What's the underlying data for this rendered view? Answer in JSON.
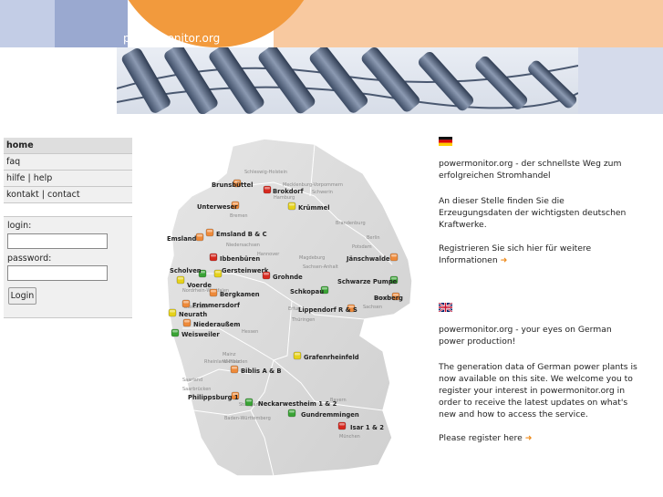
{
  "site": {
    "title": "powermonitor.org"
  },
  "nav": {
    "items": [
      {
        "label": "home",
        "active": true
      },
      {
        "label": "faq"
      },
      {
        "label": "hilfe | help"
      },
      {
        "label": "kontakt | contact"
      }
    ]
  },
  "login": {
    "login_label": "login:",
    "password_label": "password:",
    "button_label": "Login",
    "login_value": "",
    "password_value": ""
  },
  "map": {
    "state_labels": [
      "Schleswig-Holstein",
      "Mecklenburg-Vorpommern",
      "Hamburg",
      "Schwerin",
      "Bremen",
      "Niedersachsen",
      "Hannover",
      "Brandenburg",
      "Berlin",
      "Potsdam",
      "Sachsen-Anhalt",
      "Magdeburg",
      "Nordrhein-Westfalen",
      "Düsseldorf",
      "Sachsen",
      "Dresden",
      "Thüringen",
      "Erfurt",
      "Hessen",
      "Wiesbaden",
      "Rheinland-Pfalz",
      "Mainz",
      "Saarland",
      "Saarbrücken",
      "Bayern",
      "München",
      "Baden-Württemberg",
      "Stuttgart"
    ],
    "plants": [
      {
        "name": "Brunsbüttel",
        "status": "orange"
      },
      {
        "name": "Brokdorf",
        "status": "red"
      },
      {
        "name": "Unterweser",
        "status": "orange"
      },
      {
        "name": "Krümmel",
        "status": "yellow"
      },
      {
        "name": "Emsland",
        "status": "orange"
      },
      {
        "name": "Emsland B & C",
        "status": "orange"
      },
      {
        "name": "Ibbenbüren",
        "status": "red"
      },
      {
        "name": "Scholven",
        "status": "green"
      },
      {
        "name": "Gersteinwerk",
        "status": "yellow"
      },
      {
        "name": "Grohnde",
        "status": "red"
      },
      {
        "name": "Voerde",
        "status": "yellow"
      },
      {
        "name": "Bergkamen",
        "status": "orange"
      },
      {
        "name": "Frimmersdorf",
        "status": "orange"
      },
      {
        "name": "Neurath",
        "status": "yellow"
      },
      {
        "name": "Niederaußem",
        "status": "orange"
      },
      {
        "name": "Weisweiler",
        "status": "green"
      },
      {
        "name": "Jänschwalde",
        "status": "orange"
      },
      {
        "name": "Schwarze Pumpe",
        "status": "green"
      },
      {
        "name": "Schkopau",
        "status": "green"
      },
      {
        "name": "Boxberg",
        "status": "orange"
      },
      {
        "name": "Lippendorf R & S",
        "status": "orange"
      },
      {
        "name": "Grafenrheinfeld",
        "status": "yellow"
      },
      {
        "name": "Biblis A & B",
        "status": "orange"
      },
      {
        "name": "Philippsburg 1",
        "status": "orange"
      },
      {
        "name": "Neckarwestheim 1 & 2",
        "status": "green"
      },
      {
        "name": "Gundremmingen",
        "status": "green"
      },
      {
        "name": "Isar 1 & 2",
        "status": "red"
      }
    ],
    "status_colors": {
      "green": "#3aa335",
      "yellow": "#e6d21a",
      "orange": "#ee8a3a",
      "red": "#d6291f"
    }
  },
  "german": {
    "flag": "de-flag-icon",
    "heading": "powermonitor.org - der schnellste Weg zum erfolgreichen Stromhandel",
    "body": "An dieser Stelle finden Sie die Erzeugungsdaten der wichtigsten deutschen Kraftwerke.",
    "link": "Registrieren Sie sich hier für weitere Informationen"
  },
  "english": {
    "flag": "uk-flag-icon",
    "heading": "powermonitor.org - your eyes on German power production!",
    "body": "The generation data of German power plants is now available on this site. We welcome you to register your interest in powermonitor.org in order to receive the latest updates on what's new and how to access the service.",
    "link": "Please register here"
  },
  "colors": {
    "accent": "#f29a3d",
    "blue": "#9aa9d0",
    "peach": "#f8c9a0"
  }
}
